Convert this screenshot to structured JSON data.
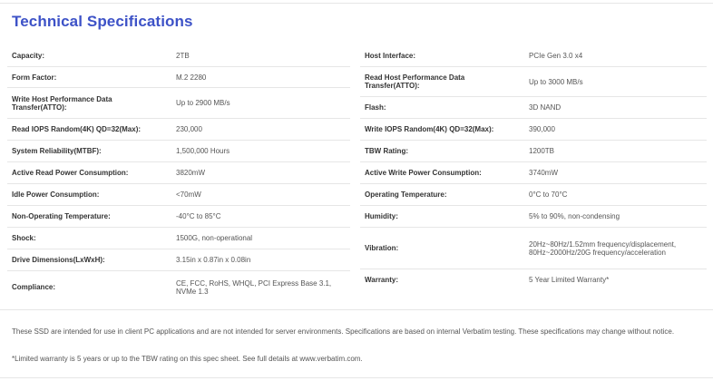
{
  "title": "Technical Specifications",
  "left_specs": [
    {
      "label": "Capacity:",
      "value": "2TB"
    },
    {
      "label": "Form Factor:",
      "value": "M.2 2280"
    },
    {
      "label": "Write Host Performance Data Transfer(ATTO):",
      "value": "Up to 2900 MB/s"
    },
    {
      "label": "Read IOPS Random(4K) QD=32(Max):",
      "value": "230,000"
    },
    {
      "label": "System Reliability(MTBF):",
      "value": "1,500,000 Hours"
    },
    {
      "label": "Active Read Power Consumption:",
      "value": "3820mW"
    },
    {
      "label": "Idle Power Consumption:",
      "value": "<70mW"
    },
    {
      "label": "Non-Operating Temperature:",
      "value": "-40°C to 85°C"
    },
    {
      "label": "Shock:",
      "value": "1500G, non-operational"
    },
    {
      "label": "Drive Dimensions(LxWxH):",
      "value": "3.15in x 0.87in x 0.08in"
    },
    {
      "label": "Compliance:",
      "value": "CE, FCC, RoHS, WHQL, PCI Express Base 3.1, NVMe 1.3"
    }
  ],
  "right_specs": [
    {
      "label": "Host Interface:",
      "value": "PCIe Gen 3.0 x4"
    },
    {
      "label": "Read Host Performance Data Transfer(ATTO):",
      "value": "Up to 3000 MB/s"
    },
    {
      "label": "Flash:",
      "value": "3D NAND"
    },
    {
      "label": "Write IOPS Random(4K) QD=32(Max):",
      "value": "390,000"
    },
    {
      "label": "TBW Rating:",
      "value": "1200TB"
    },
    {
      "label": "Active Write Power Consumption:",
      "value": "3740mW"
    },
    {
      "label": "Operating Temperature:",
      "value": "0°C to 70°C"
    },
    {
      "label": "Humidity:",
      "value": "5% to 90%, non-condensing"
    },
    {
      "label": "Vibration:",
      "value": "20Hz~80Hz/1.52mm frequency/displacement, 80Hz~2000Hz/20G frequency/acceleration"
    },
    {
      "label": "Warranty:",
      "value": "5 Year Limited Warranty*"
    }
  ],
  "notes": {
    "disclaimer": "These SSD are intended for use in client PC applications and are not intended for server environments. Specifications are based on internal Verbatim testing. These specifications may change without notice.",
    "warranty": "*Limited warranty is 5 years or up to the TBW rating on this spec sheet. See full details at www.verbatim.com."
  }
}
